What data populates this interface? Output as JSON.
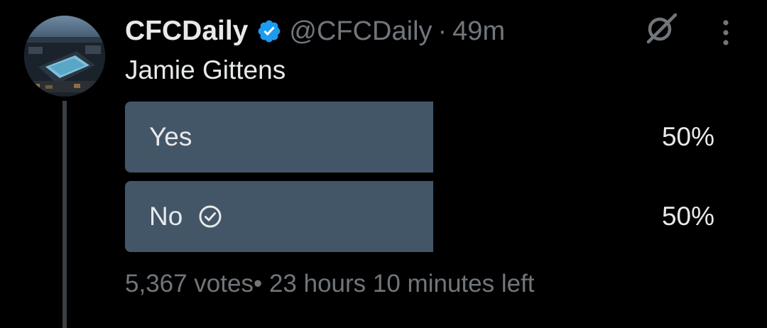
{
  "tweet": {
    "author": {
      "display_name": "CFCDaily",
      "handle": "@CFCDaily",
      "verified": true,
      "avatar_icon": "stadium-aerial-photo"
    },
    "separator": "·",
    "timestamp": "49m",
    "text": "Jamie Gittens",
    "poll": {
      "options": [
        {
          "label": "Yes",
          "percent": "50%",
          "fraction": 0.5,
          "selected": false
        },
        {
          "label": "No",
          "percent": "50%",
          "fraction": 0.5,
          "selected": true
        }
      ],
      "votes": "5,367 votes",
      "separator": "•",
      "time_left": "23 hours 10 minutes left"
    }
  },
  "icons": {
    "verified": "verified-badge-icon",
    "grok": "grok-icon",
    "more": "more-vertical-icon",
    "selected_check": "check-circle-icon"
  },
  "colors": {
    "background": "#000000",
    "text_primary": "#e7e9ea",
    "text_secondary": "#71767b",
    "verified_blue": "#1d9bf0",
    "poll_bar": "#435668",
    "thread_line": "#3a3f44"
  }
}
